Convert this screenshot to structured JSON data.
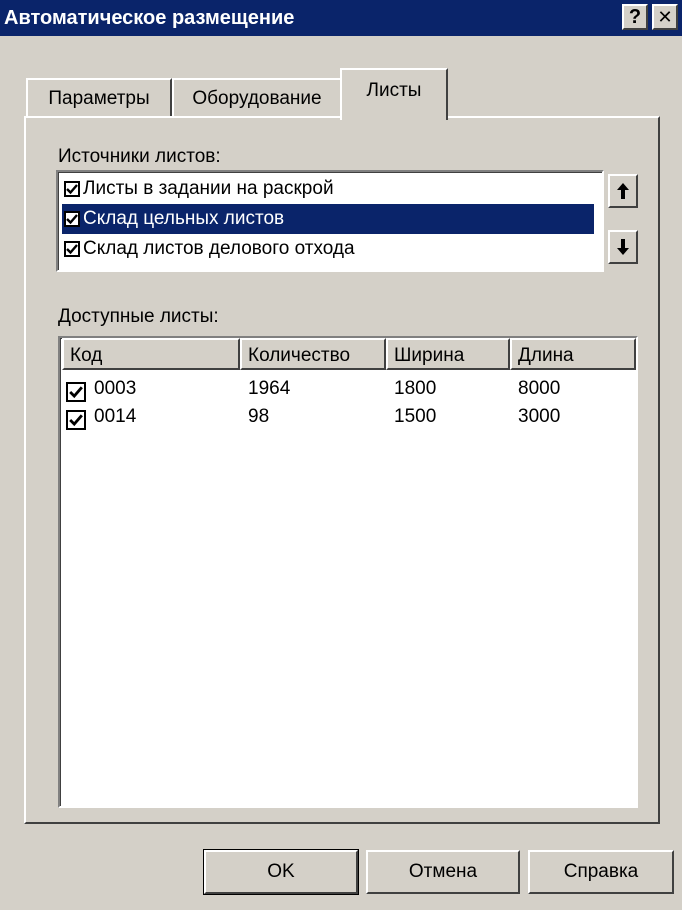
{
  "window": {
    "title": "Автоматическое размещение",
    "help_glyph": "?",
    "close_glyph": "✕"
  },
  "tabs": [
    {
      "label": "Параметры",
      "active": false
    },
    {
      "label": "Оборудование",
      "active": false
    },
    {
      "label": "Листы",
      "active": true
    }
  ],
  "sources": {
    "label": "Источники листов:",
    "items": [
      {
        "label": "Листы в задании на раскрой",
        "checked": true,
        "selected": false
      },
      {
        "label": "Склад цельных листов",
        "checked": true,
        "selected": true
      },
      {
        "label": "Склад листов делового отхода",
        "checked": true,
        "selected": false
      }
    ],
    "move_up_icon": "arrow-up-icon",
    "move_down_icon": "arrow-down-icon"
  },
  "available": {
    "label": "Доступные листы:",
    "columns": [
      "Код",
      "Количество",
      "Ширина",
      "Длина"
    ],
    "rows": [
      {
        "checked": true,
        "code": "0003",
        "quantity": "1964",
        "width": "1800",
        "length": "8000"
      },
      {
        "checked": true,
        "code": "0014",
        "quantity": "98",
        "width": "1500",
        "length": "3000"
      }
    ]
  },
  "buttons": {
    "ok": "OK",
    "cancel": "Отмена",
    "help": "Справка"
  }
}
